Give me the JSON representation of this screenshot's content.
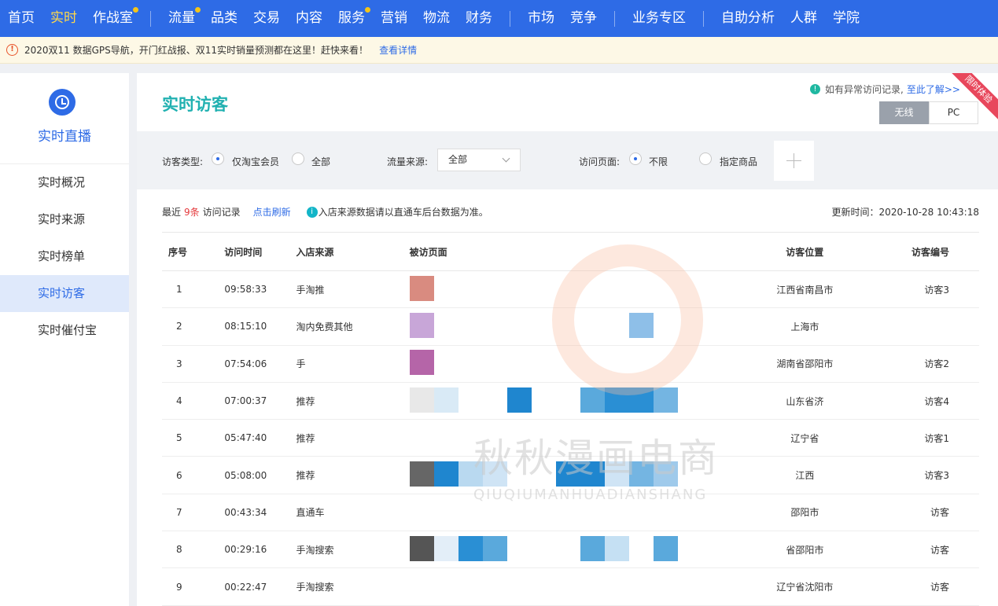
{
  "nav": {
    "items": [
      {
        "label": "首页",
        "active": false,
        "dot": false
      },
      {
        "label": "实时",
        "active": true,
        "dot": false
      },
      {
        "label": "作战室",
        "active": false,
        "dot": true
      },
      {
        "label": "流量",
        "active": false,
        "dot": true
      },
      {
        "label": "品类",
        "active": false,
        "dot": false
      },
      {
        "label": "交易",
        "active": false,
        "dot": false
      },
      {
        "label": "内容",
        "active": false,
        "dot": false
      },
      {
        "label": "服务",
        "active": false,
        "dot": true
      },
      {
        "label": "营销",
        "active": false,
        "dot": false
      },
      {
        "label": "物流",
        "active": false,
        "dot": false
      },
      {
        "label": "财务",
        "active": false,
        "dot": false
      },
      {
        "label": "市场",
        "active": false,
        "dot": false
      },
      {
        "label": "竞争",
        "active": false,
        "dot": false
      },
      {
        "label": "业务专区",
        "active": false,
        "dot": false
      },
      {
        "label": "自助分析",
        "active": false,
        "dot": false
      },
      {
        "label": "人群",
        "active": false,
        "dot": false
      },
      {
        "label": "学院",
        "active": false,
        "dot": false
      }
    ]
  },
  "notice": {
    "text": "2020双11 数据GPS导航，开门红战报、双11实时销量预测都在这里！赶快来看！",
    "link": "查看详情"
  },
  "sidebar": {
    "title": "实时直播",
    "items": [
      {
        "label": "实时概况",
        "active": false
      },
      {
        "label": "实时来源",
        "active": false
      },
      {
        "label": "实时榜单",
        "active": false
      },
      {
        "label": "实时访客",
        "active": true
      },
      {
        "label": "实时催付宝",
        "active": false
      }
    ]
  },
  "main": {
    "title": "实时访客",
    "abnormal_text": "如有异常访问记录,",
    "abnormal_link": "至此了解>>",
    "ribbon": "限时体验",
    "device": {
      "wireless": "无线",
      "pc": "PC"
    }
  },
  "filters": {
    "visitor_type_label": "访客类型:",
    "opt_member": "仅淘宝会员",
    "opt_all": "全部",
    "source_label": "流量来源:",
    "source_value": "全部",
    "page_label": "访问页面:",
    "opt_unlimited": "不限",
    "opt_goods": "指定商品"
  },
  "summary": {
    "prefix": "最近",
    "count": "9条",
    "suffix": "访问记录",
    "refresh": "点击刷新",
    "tip": "入店来源数据请以直通车后台数据为准。",
    "updated": "更新时间：2020-10-28 10:43:18"
  },
  "table": {
    "headers": [
      "序号",
      "访问时间",
      "入店来源",
      "被访页面",
      "访客位置",
      "访客编号"
    ],
    "rows": [
      {
        "no": "1",
        "time": "09:58:33",
        "source": "手淘推",
        "location": "江西省南昌市",
        "visitor": "访客3"
      },
      {
        "no": "2",
        "time": "08:15:10",
        "source": "淘内免费其他",
        "location": "上海市",
        "visitor": ""
      },
      {
        "no": "3",
        "time": "07:54:06",
        "source": "手",
        "location": "湖南省邵阳市",
        "visitor": "访客2"
      },
      {
        "no": "4",
        "time": "07:00:37",
        "source": "推荐",
        "location": "山东省济",
        "visitor": "访客4"
      },
      {
        "no": "5",
        "time": "05:47:40",
        "source": "推荐",
        "location": "辽宁省",
        "visitor": "访客1"
      },
      {
        "no": "6",
        "time": "05:08:00",
        "source": "推荐",
        "location": "江西",
        "visitor": "访客3"
      },
      {
        "no": "7",
        "time": "00:43:34",
        "source": "直通车",
        "location": "邵阳市",
        "visitor": "访客"
      },
      {
        "no": "8",
        "time": "00:29:16",
        "source": "手淘搜索",
        "location": "省邵阳市",
        "visitor": "访客"
      },
      {
        "no": "9",
        "time": "00:22:47",
        "source": "手淘搜索",
        "location": "辽宁省沈阳市",
        "visitor": "访客"
      }
    ]
  },
  "watermark": {
    "text": "秋秋漫画电商",
    "sub": "QIUQIUMANHUADIANSHANG"
  }
}
